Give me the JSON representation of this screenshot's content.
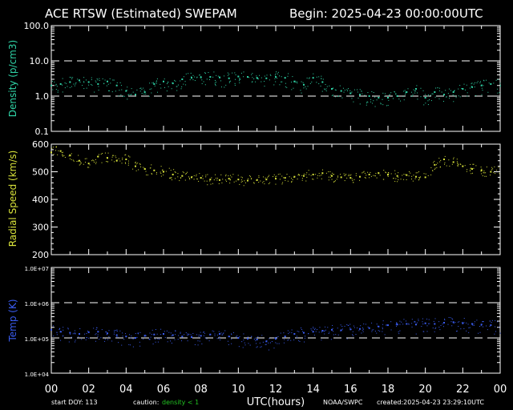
{
  "header": {
    "title": "ACE RTSW (Estimated) SWEPAM",
    "begin": "Begin: 2025-04-23 00:00:00UTC"
  },
  "footer": {
    "start_doy": "start DOY: 113",
    "caution_label": "caution:",
    "caution_value": "density < 1",
    "source": "NOAA/SWPC",
    "created": "created:2025-04-23 23:29:10UTC"
  },
  "colors": {
    "background": "#000000",
    "frame": "#ffffff",
    "density": "#2fd3a6",
    "speed": "#d8e23a",
    "temp": "#3a5cf0",
    "caution": "#22c322"
  },
  "chart_data": [
    {
      "type": "scatter",
      "ylabel": "Density (p/cm3)",
      "yscale": "log",
      "ylim": [
        0.1,
        100
      ],
      "yticks": [
        0.1,
        1.0,
        10.0,
        100.0
      ],
      "ytick_labels": [
        "0.1",
        "1.0",
        "10.0",
        "100.0"
      ],
      "ref_lines": [
        1.0,
        10.0
      ],
      "xlim": [
        0,
        24
      ],
      "color": "#2fd3a6",
      "x": [
        0,
        0.5,
        1,
        1.5,
        2,
        2.5,
        3,
        3.5,
        4,
        4.5,
        5,
        5.5,
        6,
        6.5,
        7,
        7.5,
        8,
        8.5,
        9,
        9.5,
        10,
        10.5,
        11,
        11.5,
        12,
        12.5,
        13,
        13.5,
        14,
        14.5,
        15,
        15.5,
        16,
        16.5,
        17,
        17.5,
        18,
        18.5,
        19,
        19.5,
        20,
        20.5,
        21,
        21.5,
        22,
        22.5,
        23,
        23.5
      ],
      "y": [
        2.0,
        2.2,
        2.5,
        2.8,
        2.5,
        2.2,
        2.6,
        2.0,
        1.4,
        1.1,
        1.3,
        2.2,
        2.6,
        2.3,
        3.0,
        3.3,
        3.4,
        3.5,
        3.4,
        3.2,
        3.6,
        3.5,
        3.3,
        3.2,
        3.5,
        3.3,
        2.6,
        2.1,
        3.3,
        2.5,
        1.6,
        1.4,
        1.2,
        1.1,
        1.0,
        0.9,
        0.9,
        1.0,
        1.3,
        1.6,
        0.9,
        1.3,
        1.1,
        1.3,
        1.6,
        1.8,
        2.0,
        2.2
      ]
    },
    {
      "type": "scatter",
      "ylabel": "Radial Speed (km/s)",
      "ylim": [
        200,
        600
      ],
      "yticks": [
        200,
        300,
        400,
        500,
        600
      ],
      "ytick_labels": [
        "200",
        "300",
        "400",
        "500",
        "600"
      ],
      "xlim": [
        0,
        24
      ],
      "color": "#d8e23a",
      "x": [
        0,
        0.5,
        1,
        1.5,
        2,
        2.5,
        3,
        3.5,
        4,
        4.5,
        5,
        5.5,
        6,
        6.5,
        7,
        7.5,
        8,
        8.5,
        9,
        9.5,
        10,
        10.5,
        11,
        11.5,
        12,
        12.5,
        13,
        13.5,
        14,
        14.5,
        15,
        15.5,
        16,
        16.5,
        17,
        17.5,
        18,
        18.5,
        19,
        19.5,
        20,
        20.5,
        21,
        21.5,
        22,
        22.5,
        23,
        23.5
      ],
      "y": [
        570,
        575,
        560,
        540,
        530,
        555,
        550,
        540,
        545,
        520,
        510,
        505,
        500,
        490,
        485,
        480,
        478,
        472,
        470,
        475,
        472,
        468,
        470,
        472,
        475,
        478,
        482,
        485,
        490,
        495,
        485,
        480,
        478,
        482,
        490,
        495,
        490,
        485,
        488,
        482,
        480,
        525,
        545,
        535,
        520,
        510,
        505,
        500
      ]
    },
    {
      "type": "scatter",
      "ylabel": "Temp (K)",
      "yscale": "log",
      "ylim": [
        10000,
        10000000
      ],
      "yticks": [
        10000,
        100000,
        1000000,
        10000000
      ],
      "ytick_labels": [
        "1.0E+04",
        "1.0E+05",
        "1.0E+06",
        "1.0E+07"
      ],
      "ref_lines": [
        100000,
        1000000
      ],
      "xlim": [
        0,
        24
      ],
      "xticks": [
        0,
        2,
        4,
        6,
        8,
        10,
        12,
        14,
        16,
        18,
        20,
        22,
        24
      ],
      "xtick_labels": [
        "00",
        "02",
        "04",
        "06",
        "08",
        "10",
        "12",
        "14",
        "16",
        "18",
        "20",
        "22",
        "00"
      ],
      "xlabel": "UTC(hours)",
      "color": "#3a5cf0",
      "x": [
        0,
        0.5,
        1,
        1.5,
        2,
        2.5,
        3,
        3.5,
        4,
        4.5,
        5,
        5.5,
        6,
        6.5,
        7,
        7.5,
        8,
        8.5,
        9,
        9.5,
        10,
        10.5,
        11,
        11.5,
        12,
        12.5,
        13,
        13.5,
        14,
        14.5,
        15,
        15.5,
        16,
        16.5,
        17,
        17.5,
        18,
        18.5,
        19,
        19.5,
        20,
        20.5,
        21,
        21.5,
        22,
        22.5,
        23,
        23.5
      ],
      "y": [
        170000,
        150000,
        140000,
        130000,
        145000,
        150000,
        135000,
        120000,
        110000,
        100000,
        115000,
        125000,
        130000,
        120000,
        110000,
        105000,
        115000,
        125000,
        130000,
        110000,
        100000,
        95000,
        90000,
        80000,
        95000,
        110000,
        130000,
        140000,
        150000,
        160000,
        170000,
        165000,
        175000,
        180000,
        190000,
        210000,
        230000,
        240000,
        250000,
        240000,
        260000,
        250000,
        270000,
        280000,
        260000,
        250000,
        240000,
        230000
      ]
    }
  ]
}
